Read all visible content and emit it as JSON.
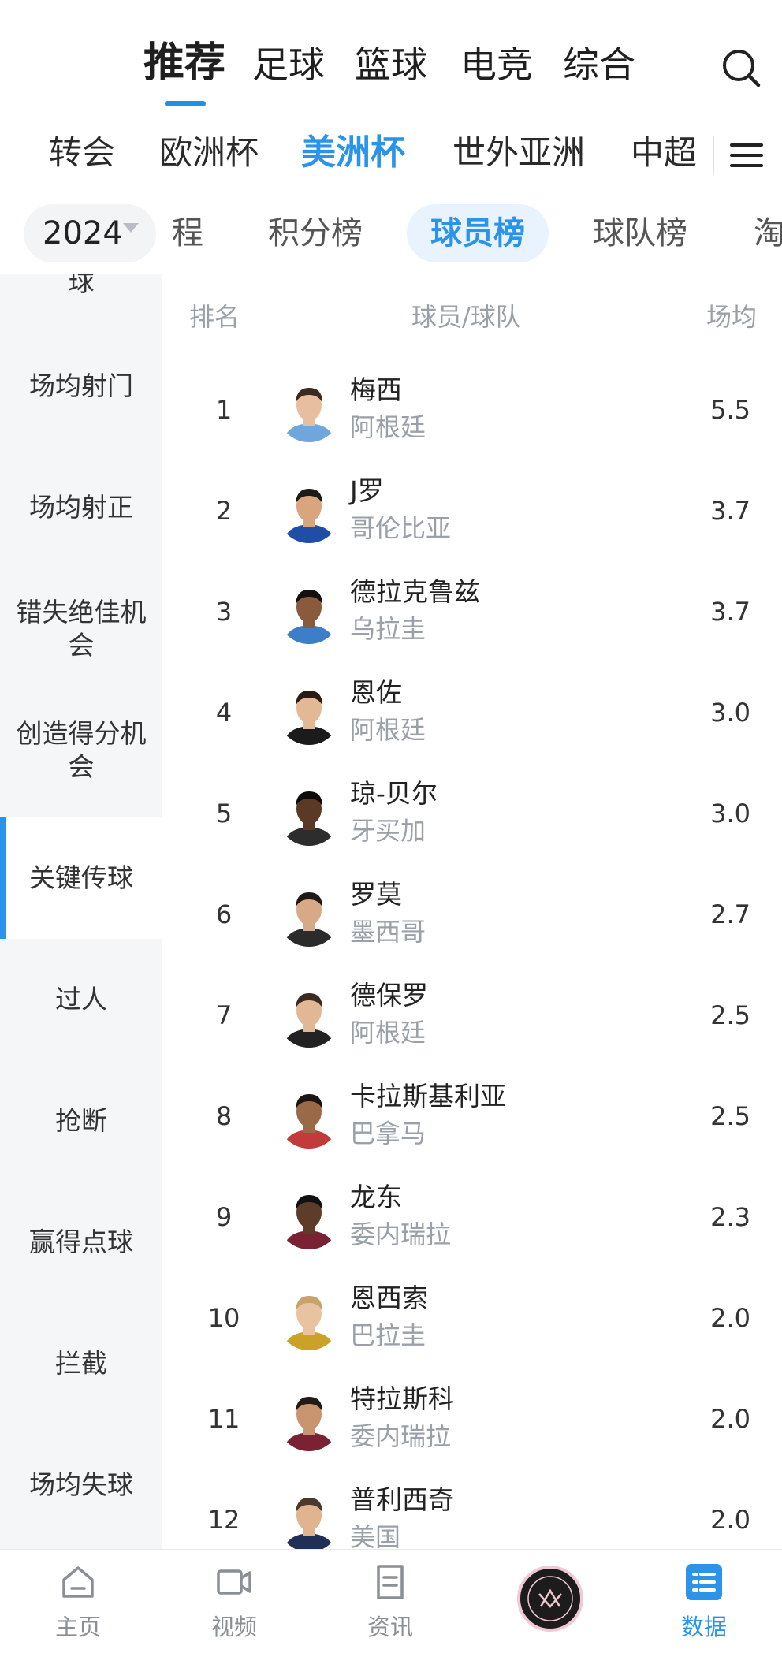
{
  "top_nav": {
    "tabs": [
      "推荐",
      "足球",
      "篮球",
      "电竞",
      "综合"
    ],
    "active_index": 0,
    "accent": "#1e90e8"
  },
  "comp_nav": {
    "items": [
      "转会",
      "欧洲杯",
      "美洲杯",
      "世外亚洲",
      "中超"
    ],
    "active_index": 2
  },
  "sub_tabs": {
    "year": "2024",
    "tabs": [
      "程",
      "积分榜",
      "球员榜",
      "球队榜",
      "淘"
    ],
    "active_index": 2
  },
  "sidebar": {
    "items": [
      "球",
      "场均射门",
      "场均射正",
      "错失绝佳机会",
      "创造得分机会",
      "关键传球",
      "过人",
      "抢断",
      "赢得点球",
      "拦截",
      "场均失球"
    ],
    "active_index": 5
  },
  "table": {
    "headers": {
      "rank": "排名",
      "player": "球员/球队",
      "value": "场均"
    },
    "rows": [
      {
        "rank": "1",
        "name": "梅西",
        "team": "阿根廷",
        "value": "5.5"
      },
      {
        "rank": "2",
        "name": "J罗",
        "team": "哥伦比亚",
        "value": "3.7"
      },
      {
        "rank": "3",
        "name": "德拉克鲁兹",
        "team": "乌拉圭",
        "value": "3.7"
      },
      {
        "rank": "4",
        "name": "恩佐",
        "team": "阿根廷",
        "value": "3.0"
      },
      {
        "rank": "5",
        "name": "琼-贝尔",
        "team": "牙买加",
        "value": "3.0"
      },
      {
        "rank": "6",
        "name": "罗莫",
        "team": "墨西哥",
        "value": "2.7"
      },
      {
        "rank": "7",
        "name": "德保罗",
        "team": "阿根廷",
        "value": "2.5"
      },
      {
        "rank": "8",
        "name": "卡拉斯基利亚",
        "team": "巴拿马",
        "value": "2.5"
      },
      {
        "rank": "9",
        "name": "龙东",
        "team": "委内瑞拉",
        "value": "2.3"
      },
      {
        "rank": "10",
        "name": "恩西索",
        "team": "巴拉圭",
        "value": "2.0"
      },
      {
        "rank": "11",
        "name": "特拉斯科",
        "team": "委内瑞拉",
        "value": "2.0"
      },
      {
        "rank": "12",
        "name": "普利西奇",
        "team": "美国",
        "value": "2.0"
      }
    ]
  },
  "bottom_nav": {
    "items": [
      {
        "label": "主页",
        "icon": "home-icon"
      },
      {
        "label": "视频",
        "icon": "video-camera-icon"
      },
      {
        "label": "资讯",
        "icon": "news-icon"
      },
      {
        "label": "",
        "icon": "club-badge"
      },
      {
        "label": "数据",
        "icon": "data-list-icon"
      }
    ],
    "active_index": 4
  }
}
